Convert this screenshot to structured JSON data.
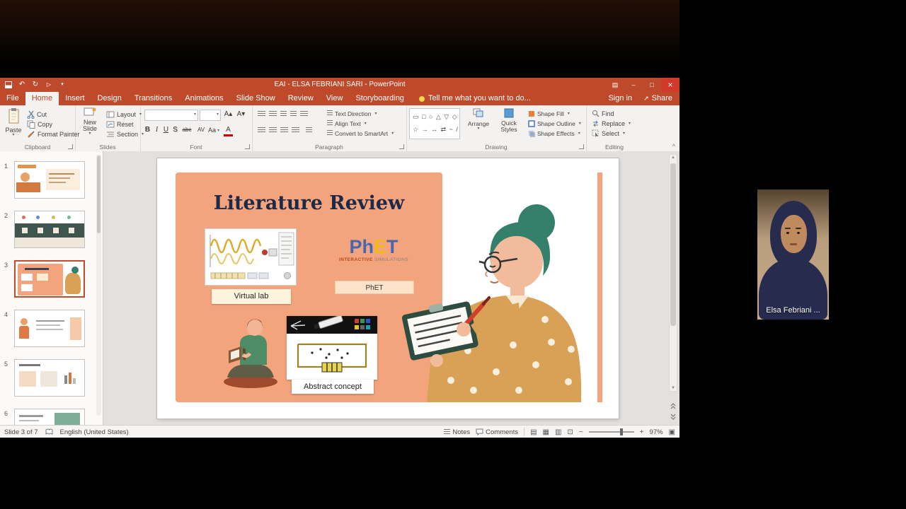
{
  "window": {
    "title": "EAI - ELSA FEBRIANI SARI - PowerPoint",
    "sign_in": "Sign in",
    "share": "Share",
    "tell_me": "Tell me what you want to do..."
  },
  "tabs": {
    "file": "File",
    "home": "Home",
    "insert": "Insert",
    "design": "Design",
    "transitions": "Transitions",
    "animations": "Animations",
    "slide_show": "Slide Show",
    "review": "Review",
    "view": "View",
    "storyboarding": "Storyboarding"
  },
  "ribbon": {
    "clipboard": {
      "group": "Clipboard",
      "paste": "Paste",
      "cut": "Cut",
      "copy": "Copy",
      "format_painter": "Format Painter"
    },
    "slides": {
      "group": "Slides",
      "new_slide": "New Slide",
      "layout": "Layout",
      "reset": "Reset",
      "section": "Section"
    },
    "font": {
      "group": "Font",
      "bold": "B",
      "italic": "I",
      "underline": "U",
      "shadow": "S",
      "strike": "abc",
      "spacing": "AV",
      "case": "Aa",
      "color": "A"
    },
    "paragraph": {
      "group": "Paragraph",
      "text_direction": "Text Direction",
      "align_text": "Align Text",
      "smartart": "Convert to SmartArt"
    },
    "drawing": {
      "group": "Drawing",
      "shapes_row1": "▭ □ ○ △ ▽ ◇",
      "shapes_row2": "☆ → ↔ ⇄ ~ /",
      "arrange": "Arrange",
      "quick_styles": "Quick Styles",
      "shape_fill": "Shape Fill",
      "shape_outline": "Shape Outline",
      "shape_effects": "Shape Effects"
    },
    "editing": {
      "group": "Editing",
      "find": "Find",
      "replace": "Replace",
      "select": "Select"
    }
  },
  "slides_panel": {
    "numbers": [
      "1",
      "2",
      "3",
      "4",
      "5",
      "6"
    ]
  },
  "slide": {
    "title": "Literature Review",
    "virtual_lab": "Virtual lab",
    "phet_caption": "PhET",
    "abstract": "Abstract concept",
    "logo": {
      "ph": "Ph",
      "e": "E",
      "t": "T",
      "sub_1": "INTERACTIVE",
      "sub_2": "SIMULATIONS"
    }
  },
  "statusbar": {
    "slide_info": "Slide 3 of 7",
    "language": "English (United States)",
    "notes": "Notes",
    "comments": "Comments",
    "zoom": "97%"
  },
  "webcam": {
    "name": "Elsa Febriani ..."
  },
  "colors": {
    "ppt_accent": "#bf4a2b",
    "slide_salmon": "#f4a47c",
    "cardigan": "#d9a155",
    "hair_green": "#35806b"
  }
}
